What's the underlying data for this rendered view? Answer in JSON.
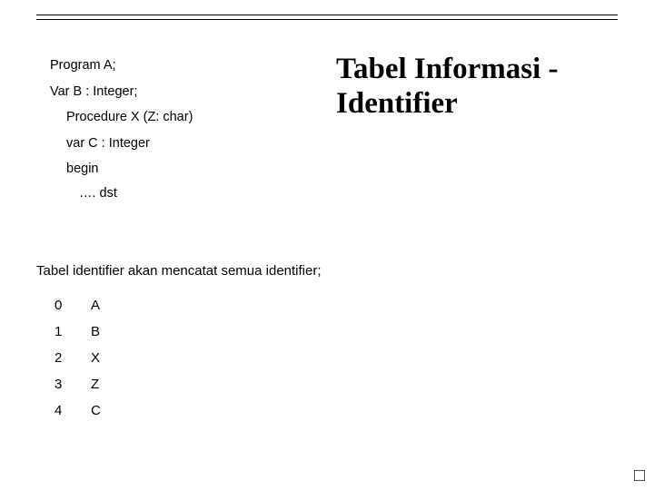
{
  "title": "Tabel Informasi - Identifier",
  "code": {
    "l1": "Program A;",
    "l2": "Var B : Integer;",
    "l3": "Procedure  X (Z: char)",
    "l4": "var C : Integer",
    "l5": "begin",
    "l6": "…. dst"
  },
  "description": "Tabel identifier akan mencatat semua identifier;",
  "table": [
    {
      "index": "0",
      "value": "A"
    },
    {
      "index": "1",
      "value": "B"
    },
    {
      "index": "2",
      "value": "X"
    },
    {
      "index": "3",
      "value": "Z"
    },
    {
      "index": "4",
      "value": "C"
    }
  ]
}
